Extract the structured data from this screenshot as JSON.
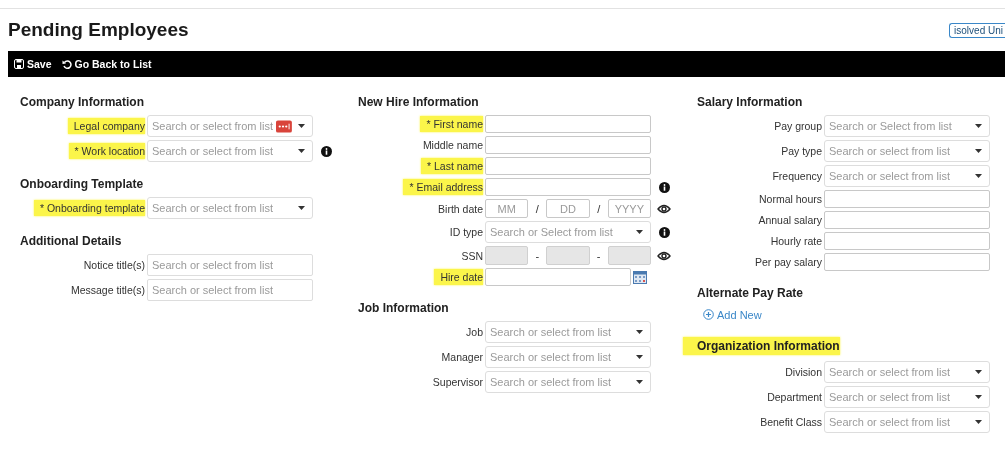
{
  "page": {
    "title": "Pending Employees",
    "badge": "isolved Uni"
  },
  "toolbar": [
    {
      "kind": "save",
      "label": "Save"
    },
    {
      "kind": "back",
      "label": "Go Back to List"
    }
  ],
  "columns": [
    {
      "sections": [
        {
          "heading": "Company Information",
          "highlighted": false,
          "fields": [
            {
              "kind": "select",
              "label": "Legal company",
              "highlighted": true,
              "placeholder": "Search or select from list",
              "addon": true
            },
            {
              "kind": "select",
              "label": "* Work location",
              "highlighted": true,
              "placeholder": "Search or select from list",
              "info_button": true
            }
          ]
        },
        {
          "heading": "Onboarding Template",
          "highlighted": false,
          "fields": [
            {
              "kind": "select",
              "label": "* Onboarding template",
              "highlighted": true,
              "placeholder": "Search or select from list"
            }
          ]
        },
        {
          "heading": "Additional Details",
          "highlighted": false,
          "fields": [
            {
              "kind": "search",
              "label": "Notice title(s)",
              "highlighted": false,
              "placeholder": "Search or select from list"
            },
            {
              "kind": "search",
              "label": "Message title(s)",
              "highlighted": false,
              "placeholder": "Search or select from list"
            }
          ]
        }
      ]
    },
    {
      "sections": [
        {
          "heading": "New Hire Information",
          "highlighted": false,
          "fields": [
            {
              "kind": "text",
              "label": "* First name",
              "highlighted": true
            },
            {
              "kind": "text",
              "label": "Middle name",
              "highlighted": false
            },
            {
              "kind": "text",
              "label": "* Last name",
              "highlighted": true
            },
            {
              "kind": "text",
              "label": "* Email address",
              "highlighted": true,
              "info_button": true
            },
            {
              "kind": "parts",
              "label": "Birth date",
              "highlighted": false,
              "parts": [
                {
                  "placeholder": "MM",
                  "disabled": false
                },
                {
                  "placeholder": "DD",
                  "disabled": false
                },
                {
                  "placeholder": "YYYY",
                  "disabled": false
                }
              ],
              "separators": [
                "/",
                "/"
              ],
              "reveal_toggle": true
            },
            {
              "kind": "select",
              "label": "ID type",
              "highlighted": false,
              "placeholder": "Search or Select from list",
              "info_button": true
            },
            {
              "kind": "parts",
              "label": "SSN",
              "highlighted": false,
              "parts": [
                {
                  "disabled": true
                },
                {
                  "disabled": true
                },
                {
                  "disabled": true
                }
              ],
              "separators": [
                "-",
                "-"
              ],
              "reveal_toggle": true
            },
            {
              "kind": "date",
              "label": "Hire date",
              "highlighted": true,
              "date_picker": true
            }
          ]
        },
        {
          "heading": "Job Information",
          "highlighted": false,
          "fields": [
            {
              "kind": "select",
              "label": "Job",
              "highlighted": false,
              "placeholder": "Search or select from list"
            },
            {
              "kind": "select",
              "label": "Manager",
              "highlighted": false,
              "placeholder": "Search or select from list"
            },
            {
              "kind": "select",
              "label": "Supervisor",
              "highlighted": false,
              "placeholder": "Search or select from list"
            }
          ]
        }
      ]
    },
    {
      "sections": [
        {
          "heading": "Salary Information",
          "highlighted": false,
          "fields": [
            {
              "kind": "select",
              "label": "Pay group",
              "highlighted": false,
              "placeholder": "Search or Select from list"
            },
            {
              "kind": "select",
              "label": "Pay type",
              "highlighted": false,
              "placeholder": "Search or select from list"
            },
            {
              "kind": "select",
              "label": "Frequency",
              "highlighted": false,
              "placeholder": "Search or select from list"
            },
            {
              "kind": "text",
              "label": "Normal hours",
              "highlighted": false
            },
            {
              "kind": "text",
              "label": "Annual salary",
              "highlighted": false
            },
            {
              "kind": "text",
              "label": "Hourly rate",
              "highlighted": false
            },
            {
              "kind": "text",
              "label": "Per pay salary",
              "highlighted": false
            }
          ]
        },
        {
          "heading": "Alternate Pay Rate",
          "highlighted": false,
          "fields": [
            {
              "kind": "link",
              "label": "Add New"
            }
          ]
        },
        {
          "heading": "Organization Information",
          "highlighted": true,
          "fields": [
            {
              "kind": "select",
              "label": "Division",
              "highlighted": false,
              "placeholder": "Search or select from list"
            },
            {
              "kind": "select",
              "label": "Department",
              "highlighted": false,
              "placeholder": "Search or select from list"
            },
            {
              "kind": "select",
              "label": "Benefit Class",
              "highlighted": false,
              "placeholder": "Search or select from list"
            }
          ]
        }
      ]
    }
  ]
}
